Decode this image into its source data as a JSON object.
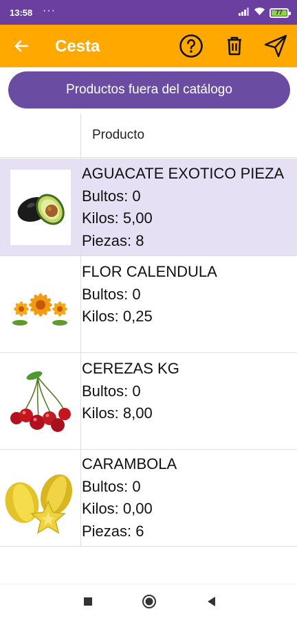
{
  "status_bar": {
    "time": "13:58",
    "dots": "···",
    "battery": "77"
  },
  "app_bar": {
    "title": "Cesta"
  },
  "catalog_button": {
    "label": "Productos fuera del catálogo"
  },
  "table": {
    "header": "Producto",
    "rows": [
      {
        "name": "AGUACATE EXOTICO PIEZA",
        "bultos": "Bultos: 0",
        "kilos": "Kilos: 5,00",
        "piezas": "Piezas: 8",
        "image": "avocado-image"
      },
      {
        "name": "FLOR CALENDULA",
        "bultos": "Bultos: 0",
        "kilos": "Kilos: 0,25",
        "image": "calendula-flower-image"
      },
      {
        "name": "CEREZAS KG",
        "bultos": "Bultos: 0",
        "kilos": "Kilos: 8,00",
        "image": "cherries-image"
      },
      {
        "name": "CARAMBOLA",
        "bultos": "Bultos: 0",
        "kilos": "Kilos: 0,00",
        "piezas": "Piezas: 6",
        "image": "starfruit-image"
      }
    ]
  },
  "colors": {
    "status": "#6a3fa0",
    "appbar": "#ffa800",
    "pill": "#6b4ca3",
    "selected_row": "#e6e0f4"
  },
  "icons": [
    "back-arrow-icon",
    "help-icon",
    "trash-icon",
    "send-icon",
    "nav-square-icon",
    "nav-circle-icon",
    "nav-triangle-icon"
  ]
}
